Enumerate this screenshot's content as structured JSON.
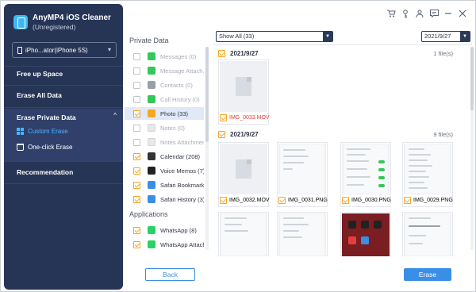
{
  "app": {
    "title": "AnyMP4 iOS Cleaner",
    "status": "(Unregistered)"
  },
  "device": {
    "name": "iPho...ator(iPhone 5S)"
  },
  "sidebar": {
    "free_up_space": "Free up Space",
    "erase_all_data": "Erase All Data",
    "erase_private_data": "Erase Private Data",
    "custom_erase": "Custom Erase",
    "one_click_erase": "One-click Erase",
    "recommendation": "Recommendation"
  },
  "categories": {
    "private_heading": "Private Data",
    "apps_heading": "Applications",
    "items": [
      {
        "label": "Messages (0)",
        "checked": false,
        "dim": true,
        "icon_color": "#34c759"
      },
      {
        "label": "Message Attach...",
        "checked": false,
        "dim": true,
        "icon_color": "#34c759"
      },
      {
        "label": "Contacts (0)",
        "checked": false,
        "dim": true,
        "icon_color": "#9aa0a8"
      },
      {
        "label": "Call History (0)",
        "checked": false,
        "dim": true,
        "icon_color": "#34c759"
      },
      {
        "label": "Photo (33)",
        "checked": true,
        "dim": false,
        "active": true,
        "icon_color": "#f5a623"
      },
      {
        "label": "Notes (0)",
        "checked": false,
        "dim": true,
        "icon_color": "#e8e8e8"
      },
      {
        "label": "Notes Attachmen...",
        "checked": false,
        "dim": true,
        "icon_color": "#e8e8e8"
      },
      {
        "label": "Calendar (208)",
        "checked": true,
        "dim": false,
        "icon_color": "#333333"
      },
      {
        "label": "Voice Memos (7)",
        "checked": true,
        "dim": false,
        "icon_color": "#222222"
      },
      {
        "label": "Safari Bookmark (...",
        "checked": true,
        "dim": false,
        "icon_color": "#3a8ee6"
      },
      {
        "label": "Safari History (3)",
        "checked": true,
        "dim": false,
        "icon_color": "#3a8ee6"
      }
    ],
    "apps": [
      {
        "label": "WhatsApp (8)",
        "checked": true,
        "icon_color": "#25d366"
      },
      {
        "label": "WhatsApp Attach...",
        "checked": true,
        "icon_color": "#25d366"
      }
    ]
  },
  "toolbar": {
    "filter": "Show All (33)",
    "date": "2021/9/27",
    "dropdown_icon": "chevron-down-icon"
  },
  "groups": [
    {
      "date": "2021/9/27",
      "count": "1 file(s)"
    },
    {
      "date": "2021/9/27",
      "count": "9 file(s)"
    }
  ],
  "thumbnails": [
    {
      "name": "IMG_0033.MOV",
      "highlight": true
    },
    {
      "name": "IMG_0032.MOV"
    },
    {
      "name": "IMG_0031.PNG"
    },
    {
      "name": "IMG_0030.PNG"
    },
    {
      "name": "IMG_0029.PNG"
    }
  ],
  "buttons": {
    "back": "Back",
    "erase": "Erase"
  },
  "colors": {
    "sidebar": "#263456",
    "accent": "#3a8ee6",
    "check": "#f5a623",
    "highlight_text": "#e53d3d"
  }
}
